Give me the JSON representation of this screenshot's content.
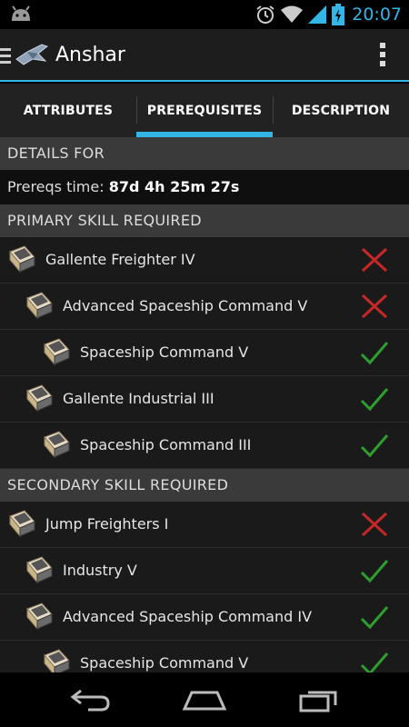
{
  "status_bar": {
    "time": "20:07",
    "icons": [
      "android-icon",
      "alarm-icon",
      "wifi-icon",
      "signal-icon",
      "battery-icon"
    ]
  },
  "action_bar": {
    "title": "Anshar",
    "icons": [
      "menu-icon",
      "ship-logo-icon",
      "overflow-menu-icon"
    ]
  },
  "tabs": [
    {
      "label": "ATTRIBUTES",
      "selected": false
    },
    {
      "label": "PREREQUISITES",
      "selected": true
    },
    {
      "label": "DESCRIPTION",
      "selected": false
    }
  ],
  "details": {
    "header": "DETAILS FOR",
    "prereqs_label": "Prereqs time:",
    "prereqs_time": "87d 4h 25m 27s"
  },
  "primary": {
    "header": "PRIMARY SKILL REQUIRED",
    "items": [
      {
        "name": "Gallente Freighter IV",
        "level": 0,
        "status": "missing"
      },
      {
        "name": "Advanced Spaceship Command V",
        "level": 1,
        "status": "missing"
      },
      {
        "name": "Spaceship Command V",
        "level": 2,
        "status": "ok"
      },
      {
        "name": "Gallente Industrial III",
        "level": 1,
        "status": "ok"
      },
      {
        "name": "Spaceship Command III",
        "level": 2,
        "status": "ok"
      }
    ]
  },
  "secondary": {
    "header": "SECONDARY SKILL REQUIRED",
    "items": [
      {
        "name": "Jump Freighters I",
        "level": 0,
        "status": "missing"
      },
      {
        "name": "Industry V",
        "level": 1,
        "status": "ok"
      },
      {
        "name": "Advanced Spaceship Command IV",
        "level": 1,
        "status": "ok"
      },
      {
        "name": "Spaceship Command V",
        "level": 2,
        "status": "ok"
      }
    ]
  },
  "colors": {
    "accent": "#33b5e5",
    "ok": "#2e9e2e",
    "missing": "#c62828"
  },
  "nav_bar": {
    "icons": [
      "back-icon",
      "home-icon",
      "recent-apps-icon"
    ]
  }
}
